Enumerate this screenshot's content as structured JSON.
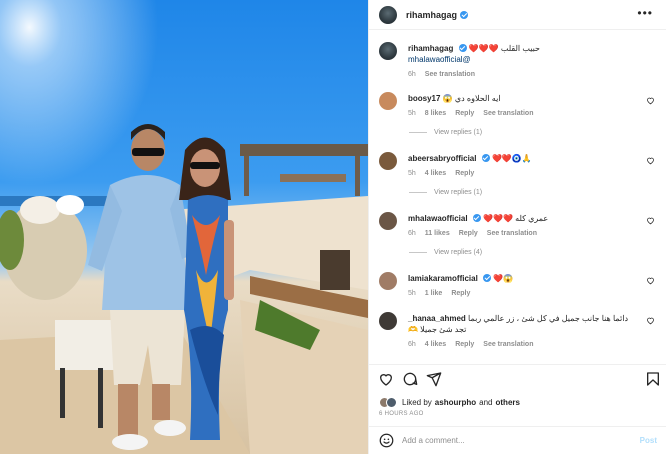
{
  "post": {
    "username": "rihamhagag",
    "caption_text": "حبيب القلب ❤️❤️❤️",
    "caption_mention": "mhalawaofficial@",
    "caption_time": "6h",
    "see_translation": "See translation"
  },
  "comments": [
    {
      "username": "boosy17",
      "text": "ايه الحلاوه دي 😱",
      "time": "5h",
      "likes": "8 likes",
      "reply": "Reply",
      "translate": "See translation",
      "view_replies": "View replies (1)",
      "avatar_color": "#c88a5d"
    },
    {
      "username": "abeersabryofficial",
      "verified": true,
      "text": "❤️❤️🧿🙏",
      "time": "5h",
      "likes": "4 likes",
      "reply": "Reply",
      "view_replies": "View replies (1)",
      "avatar_color": "#7a5a3c"
    },
    {
      "username": "mhalawaofficial",
      "verified": true,
      "text": "عمري كله ❤️❤️❤️",
      "time": "6h",
      "likes": "11 likes",
      "reply": "Reply",
      "translate": "See translation",
      "view_replies": "View replies (4)",
      "avatar_color": "#6b5646"
    },
    {
      "username": "lamiakaramofficial",
      "verified": true,
      "text": "❤️😱",
      "time": "5h",
      "likes": "1 like",
      "reply": "Reply",
      "avatar_color": "#a07c66"
    },
    {
      "username": "_hanaa_ahmed",
      "text": "دائما هنا جانب جميل في كل شئ ، زر عالمي ربما تجد شئ جميلا 🫶",
      "time": "6h",
      "likes": "4 likes",
      "reply": "Reply",
      "translate": "See translation",
      "avatar_color": "#3f3a36"
    }
  ],
  "actions": {
    "liked_by_prefix": "Liked by",
    "liked_by_user": "ashourpho",
    "liked_by_and": "and",
    "liked_by_others": "others",
    "time_ago": "6 HOURS AGO"
  },
  "composer": {
    "placeholder": "Add a comment...",
    "post_label": "Post"
  },
  "colors": {
    "verified": "#3897f0",
    "heart": "#ed4956",
    "link": "#00376b"
  }
}
